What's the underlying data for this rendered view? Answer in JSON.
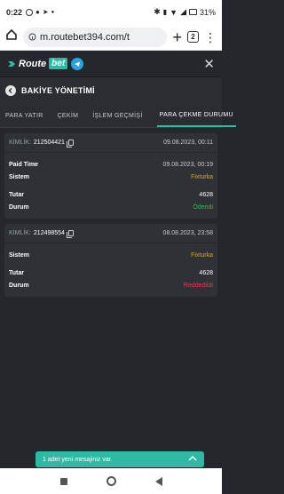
{
  "status_bar": {
    "time": "0:22",
    "battery": "31%"
  },
  "browser": {
    "url": "m.routebet394.com/t",
    "tab_count": "2"
  },
  "app": {
    "logo_word": "Route",
    "logo_box": "bet"
  },
  "page": {
    "title": "BAKİYE YÖNETİMİ"
  },
  "tabs": [
    {
      "label": "PARA YATIR"
    },
    {
      "label": "ÇEKİM"
    },
    {
      "label": "İŞLEM GEÇMİŞİ"
    },
    {
      "label": "PARA ÇEKME DURUMU"
    }
  ],
  "transactions": [
    {
      "id_label": "KİMLİK:",
      "id": "212504421",
      "date": "09.08.2023, 00:11",
      "paid_time_label": "Paid Time",
      "paid_time": "09.08.2023, 00:19",
      "system_label": "Sistem",
      "system": "Fixturka",
      "amount_label": "Tutar",
      "amount": "4628",
      "status_label": "Durum",
      "status": "Ödendi"
    },
    {
      "id_label": "KİMLİK:",
      "id": "212498554",
      "date": "08.08.2023, 23:58",
      "system_label": "Sistem",
      "system": "Fixturka",
      "amount_label": "Tutar",
      "amount": "4628",
      "status_label": "Durum",
      "status": "Reddedildi"
    }
  ],
  "toast": {
    "message": "1 adet yeni mesajiniz var."
  },
  "colors": {
    "accent": "#2fb9a5",
    "success": "#2ebd4f",
    "danger": "#e23d4b",
    "system": "#e0a52a"
  }
}
